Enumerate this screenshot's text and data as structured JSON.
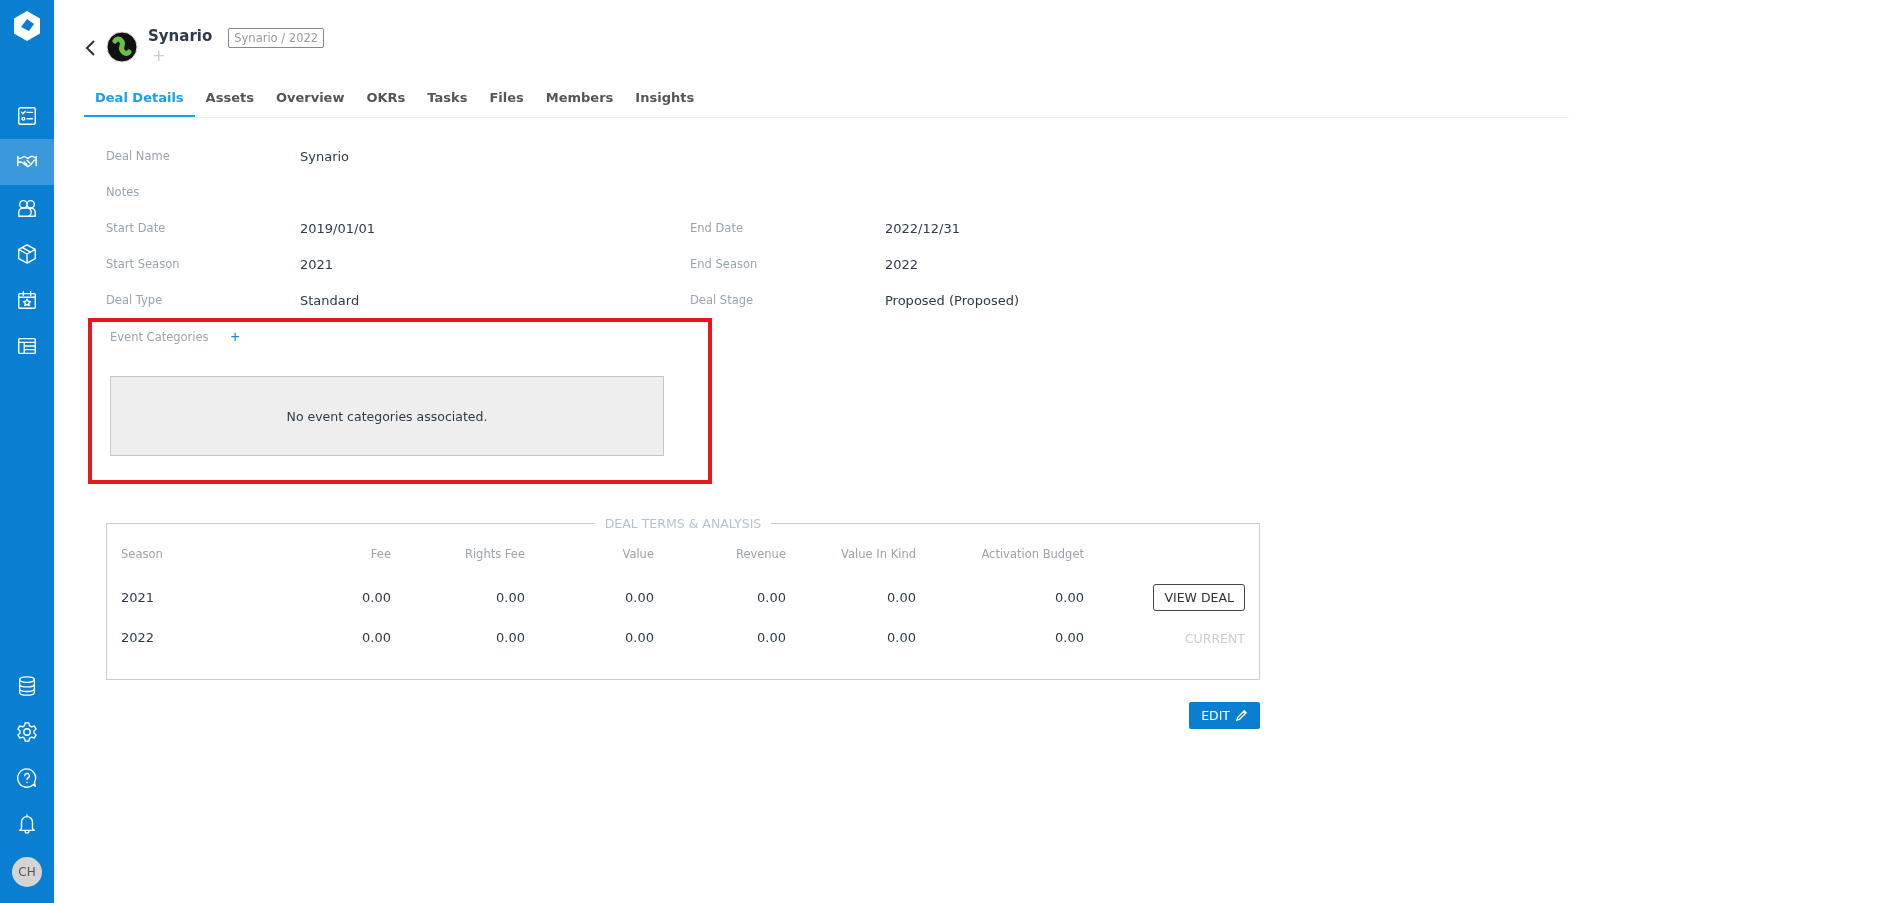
{
  "sidebar": {
    "top_items": [
      {
        "kind": "checklist",
        "selected": false
      },
      {
        "kind": "handshake",
        "selected": true
      },
      {
        "kind": "people",
        "selected": false
      },
      {
        "kind": "box",
        "selected": false
      },
      {
        "kind": "calendar",
        "selected": false
      },
      {
        "kind": "table",
        "selected": false
      }
    ],
    "bottom_items": [
      {
        "kind": "database"
      },
      {
        "kind": "gear"
      },
      {
        "kind": "help"
      },
      {
        "kind": "bell"
      }
    ],
    "avatar": "CH"
  },
  "header": {
    "title": "Synario",
    "tag": "Synario / 2022",
    "add": "+"
  },
  "tabs": [
    {
      "label": "Deal Details",
      "selected": true
    },
    {
      "label": "Assets",
      "selected": false
    },
    {
      "label": "Overview",
      "selected": false
    },
    {
      "label": "OKRs",
      "selected": false
    },
    {
      "label": "Tasks",
      "selected": false
    },
    {
      "label": "Files",
      "selected": false
    },
    {
      "label": "Members",
      "selected": false
    },
    {
      "label": "Insights",
      "selected": false
    }
  ],
  "details": [
    [
      {
        "label": "Deal Name",
        "value": "Synario"
      }
    ],
    [
      {
        "label": "Notes"
      }
    ],
    [
      {
        "label": "Start Date",
        "value": "2019/01/01"
      },
      {
        "label": "End Date",
        "value": "2022/12/31"
      }
    ],
    [
      {
        "label": "Start Season",
        "value": "2021"
      },
      {
        "label": "End Season",
        "value": "2022"
      }
    ],
    [
      {
        "label": "Deal Type",
        "value": "Standard"
      },
      {
        "label": "Deal Stage",
        "value": "Proposed (Proposed)"
      }
    ]
  ],
  "event_categories": {
    "label": "Event Categories",
    "add": "+",
    "empty": "No event categories associated.",
    "highlighted": true
  },
  "deal_terms": {
    "title": "DEAL TERMS & ANALYSIS",
    "columns": [
      "Season",
      "Fee",
      "Rights Fee",
      "Value",
      "Revenue",
      "Value In Kind",
      "Activation Budget"
    ],
    "rows": [
      {
        "cells": [
          "2021",
          "0.00",
          "0.00",
          "0.00",
          "0.00",
          "0.00",
          "0.00"
        ],
        "action": {
          "kind": "button",
          "label": "VIEW DEAL"
        }
      },
      {
        "cells": [
          "2022",
          "0.00",
          "0.00",
          "0.00",
          "0.00",
          "0.00",
          "0.00"
        ],
        "action": {
          "kind": "status",
          "label": "CURRENT"
        }
      }
    ]
  },
  "edit_button": "EDIT"
}
